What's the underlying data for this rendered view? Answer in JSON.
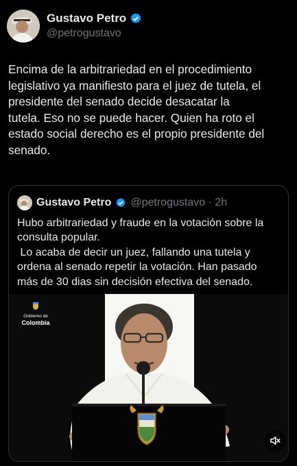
{
  "post": {
    "author_name": "Gustavo Petro",
    "handle": "@petrogustavo",
    "text": "Encima de la arbitrariedad en el procedimiento\nlegislativo ya manifiesto para el juez de tutela, el\npresidente del senado decide desacatar la\ntutela. Eso no se puede hacer. Quien ha roto el\nestado social derecho es el propio presidente del\nsenado."
  },
  "quoted": {
    "author_name": "Gustavo Petro",
    "handle_time": "@petrogustavo · 2h",
    "text": "Hubo arbitrariedad y fraude en la votación sobre la\nconsulta popular.\n Lo acaba de decir un juez, fallando una tutela y\nordena al senado repetir la votación. Han pasado\nmás de 30 dias sin decisión efectiva del senado.",
    "media": {
      "logo_line1": "Gobierno de",
      "logo_line2": "Colombia"
    }
  },
  "colors": {
    "background": "#000000",
    "text": "#e7e9ea",
    "secondary": "#71767b",
    "verified": "#1d9bf0",
    "border": "#2f3336"
  },
  "icons": [
    "verified-badge-icon",
    "mute-icon",
    "colombia-coat-of-arms-icon"
  ]
}
